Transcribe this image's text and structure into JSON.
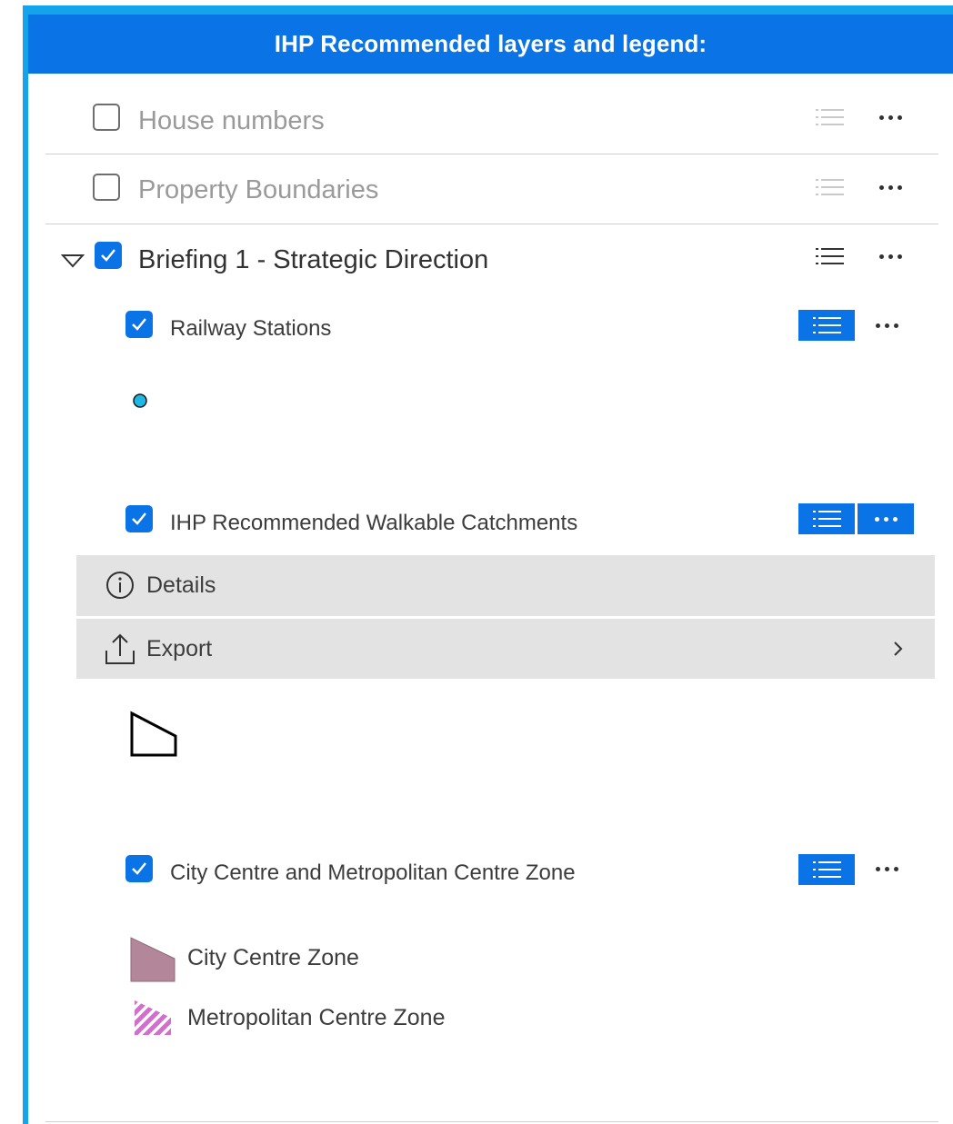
{
  "header": {
    "title": "IHP Recommended layers and legend:"
  },
  "layers": [
    {
      "label": "House numbers",
      "checked": false
    },
    {
      "label": "Property Boundaries",
      "checked": false
    },
    {
      "label": "Briefing 1 - Strategic Direction",
      "checked": true,
      "expanded": true
    }
  ],
  "sublayers": [
    {
      "label": "Railway Stations",
      "checked": true
    },
    {
      "label": "IHP Recommended Walkable Catchments",
      "checked": true
    },
    {
      "label": "City Centre and Metropolitan Centre Zone",
      "checked": true
    }
  ],
  "actions_menu": {
    "details_label": "Details",
    "export_label": "Export"
  },
  "legend": {
    "city_centre_label": "City Centre Zone",
    "metropolitan_label": "Metropolitan Centre Zone"
  },
  "colors": {
    "accent": "#0a73e6",
    "frame": "#14a4ec",
    "station_marker": "#1cb8e8",
    "city_centre_fill": "#b3869a",
    "metropolitan_stripe": "#d66bd0"
  }
}
